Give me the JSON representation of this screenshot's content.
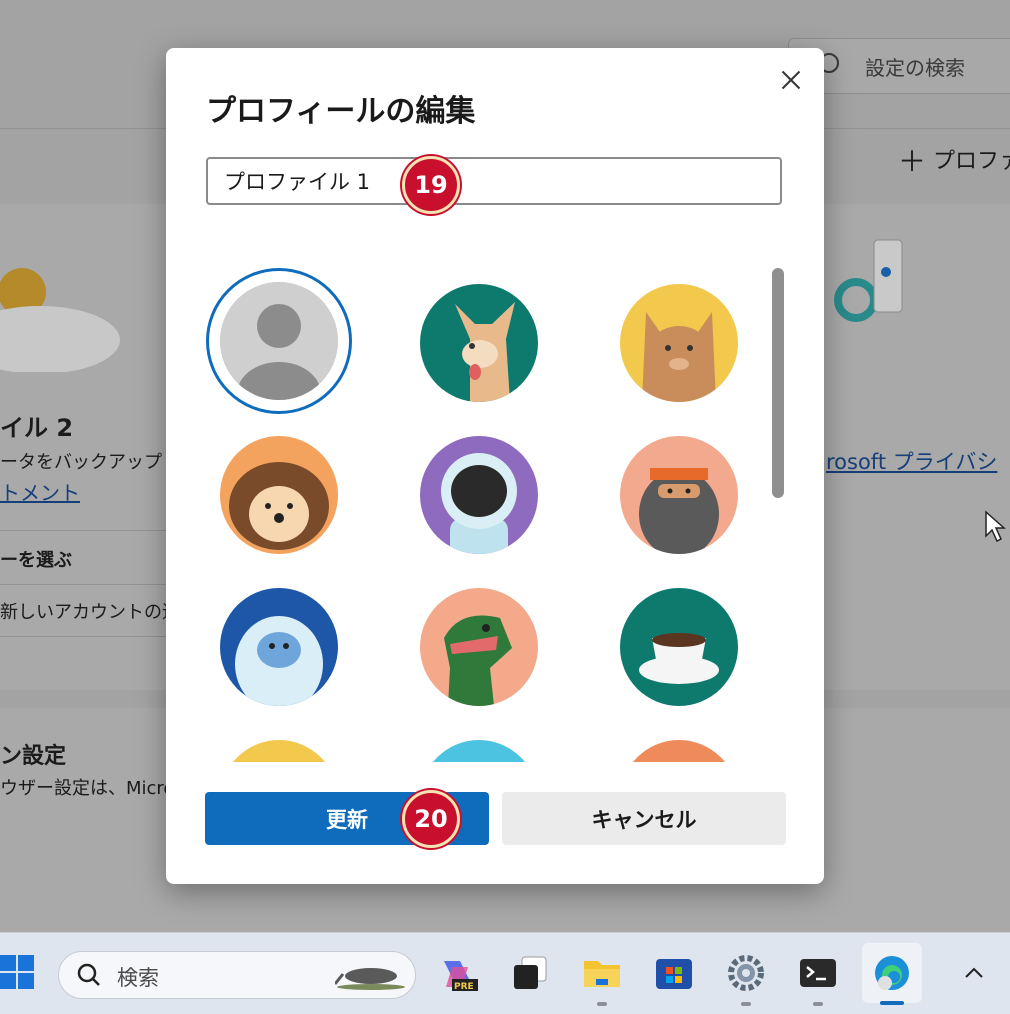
{
  "background": {
    "search_placeholder": "設定の検索",
    "add_profile": "プロファイ",
    "profile_name": "イル 2",
    "backup_text": "ータをバックアップし、",
    "statement_link": "トメント",
    "privacy_link": "rosoft プライバシ",
    "choose_text": "ーを選ぶ",
    "add_account": "新しいアカウントの追加",
    "settings_heading": "ン設定",
    "browser_settings": "ウザー設定は、Micros"
  },
  "dialog": {
    "title": "プロフィールの編集",
    "name_value": "プロファイル 1",
    "badge_name": "19",
    "badge_update": "20",
    "update_label": "更新",
    "cancel_label": "キャンセル"
  },
  "avatars": [
    {
      "name": "default-person",
      "bg": "#d4d4d4"
    },
    {
      "name": "dog",
      "bg": "#0e7a6e"
    },
    {
      "name": "cat",
      "bg": "#f2c94c"
    },
    {
      "name": "hedgehog",
      "bg": "#f3a35e"
    },
    {
      "name": "astronaut",
      "bg": "#8e6bbf"
    },
    {
      "name": "ninja",
      "bg": "#f2a98d"
    },
    {
      "name": "yeti",
      "bg": "#1f57a8"
    },
    {
      "name": "dinosaur",
      "bg": "#f3a98a"
    },
    {
      "name": "coffee",
      "bg": "#0e7a6e"
    }
  ],
  "taskbar": {
    "search_text": "検索"
  }
}
